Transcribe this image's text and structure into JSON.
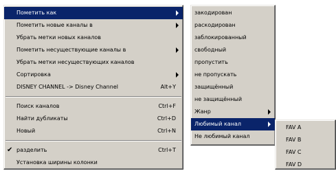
{
  "main_menu": {
    "items": [
      {
        "label": "Пометить как",
        "submenu": true,
        "selected": true
      },
      {
        "label": "Пометить новые каналы в",
        "submenu": true
      },
      {
        "label": "Убрать метки новых каналов"
      },
      {
        "label": "Пометить несуществующие каналы в",
        "submenu": true
      },
      {
        "label": "Убрать метки несуществующих каналов"
      },
      {
        "label": "Сортировка",
        "submenu": true
      },
      {
        "label": "DISNEY CHANNEL -> Disney Channel",
        "shortcut": "Alt+Y"
      },
      {
        "label": "Поиск каналов",
        "shortcut": "Ctrl+F"
      },
      {
        "label": "Найти дубликаты",
        "shortcut": "Ctrl+D"
      },
      {
        "label": "Новый",
        "shortcut": "Ctrl+N"
      },
      {
        "label": "разделить",
        "shortcut": "Ctrl+T",
        "checked": true,
        "check_glyph": "✔"
      },
      {
        "label": "Установка ширины колонки"
      }
    ]
  },
  "mark_as_submenu": {
    "items": [
      {
        "label": "закодирован"
      },
      {
        "label": "раскодирован"
      },
      {
        "label": "заблокированный"
      },
      {
        "label": "свободный"
      },
      {
        "label": "пропустить"
      },
      {
        "label": "не пропускать"
      },
      {
        "label": "защищённый"
      },
      {
        "label": "не защищённый"
      },
      {
        "label": "Жанр",
        "submenu": true
      },
      {
        "label": "Любимый канал",
        "submenu": true,
        "selected": true
      },
      {
        "label": "Не любимый канал"
      }
    ]
  },
  "favorite_submenu": {
    "items": [
      {
        "label": "FAV A"
      },
      {
        "label": "FAV B"
      },
      {
        "label": "FAV C"
      },
      {
        "label": "FAV D"
      }
    ]
  },
  "colors": {
    "menu_face": "#d4d0c8",
    "selection": "#0a246a",
    "selection_text": "#ffffff",
    "background": "#ffffff"
  }
}
